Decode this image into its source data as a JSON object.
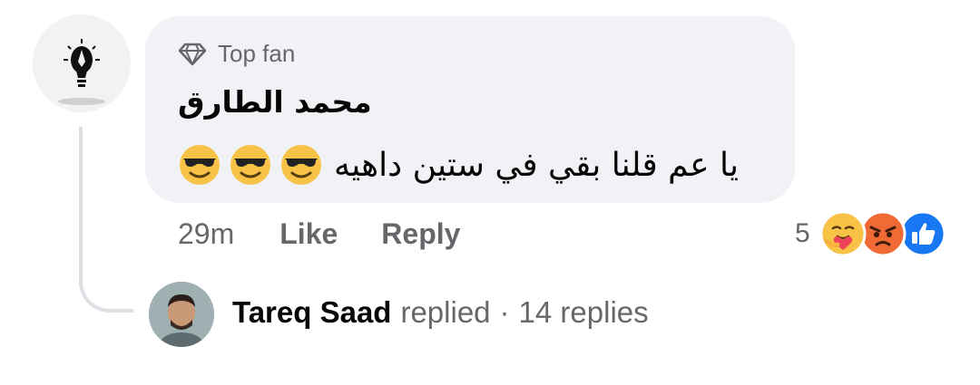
{
  "comment": {
    "badge": "Top fan",
    "author": "محمد الطارق",
    "text": "يا عم قلنا بقي في ستين داهيه",
    "emojis": [
      "smiling-face-with-sunglasses",
      "smiling-face-with-sunglasses",
      "smiling-face-with-sunglasses"
    ],
    "timestamp": "29m",
    "like_label": "Like",
    "reply_label": "Reply",
    "reaction_count": "5",
    "reactions": [
      "care",
      "angry",
      "like"
    ]
  },
  "replies": {
    "author": "Tareq Saad",
    "action": "replied",
    "separator": "·",
    "count_text": "14 replies"
  },
  "colors": {
    "bubble": "#f0f2f5",
    "secondary_text": "#65676b",
    "primary_text": "#050505",
    "like_blue": "#1877f2",
    "thread_line": "#dcdfe3"
  }
}
